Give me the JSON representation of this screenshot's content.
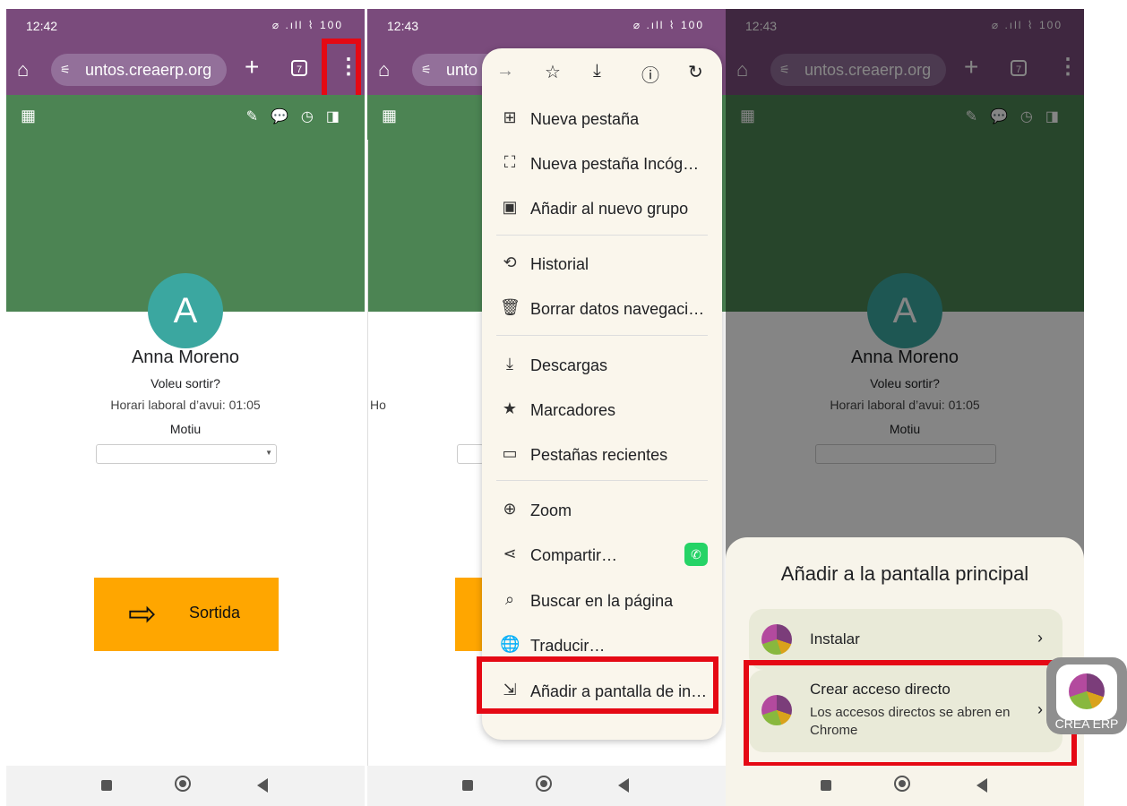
{
  "status": {
    "time1": "12:42",
    "time2": "12:43",
    "time3": "12:43",
    "icons": "⌀ .ıll ⌇ 100"
  },
  "browser": {
    "url": "untos.creaerp.org",
    "url_truncated": "unto",
    "tab_count": "7"
  },
  "profile": {
    "initial": "A",
    "name": "Anna Moreno",
    "question": "Voleu sortir?",
    "hours": "Horari laboral d’avui: 01:05",
    "hours_partial": "Ho",
    "reason_label": "Motiu",
    "exit_button": "Sortida"
  },
  "menu": {
    "items": [
      {
        "label": "Nueva pestaña",
        "icon": "plus-box-icon"
      },
      {
        "label": "Nueva pestaña Incóg…",
        "icon": "incognito-icon"
      },
      {
        "label": "Añadir al nuevo grupo",
        "icon": "group-icon"
      },
      {
        "label": "Historial",
        "icon": "history-icon"
      },
      {
        "label": "Borrar datos navegaci…",
        "icon": "trash-icon"
      },
      {
        "label": "Descargas",
        "icon": "download-check-icon"
      },
      {
        "label": "Marcadores",
        "icon": "star-icon"
      },
      {
        "label": "Pestañas recientes",
        "icon": "devices-icon"
      },
      {
        "label": "Zoom",
        "icon": "zoom-icon"
      },
      {
        "label": "Compartir…",
        "icon": "share-icon"
      },
      {
        "label": "Buscar en la página",
        "icon": "find-icon"
      },
      {
        "label": "Traducir…",
        "icon": "translate-icon"
      },
      {
        "label": "Añadir a pantalla de in…",
        "icon": "add-to-home-icon"
      }
    ]
  },
  "sheet": {
    "title": "Añadir a la pantalla principal",
    "install": "Instalar",
    "shortcut_title": "Crear acceso directo",
    "shortcut_sub": "Los accesos directos se abren en Chrome"
  },
  "app_icon_label": "CREA ERP",
  "colors": {
    "toolbar": "#7a4b7c",
    "header": "#4c8453",
    "avatar": "#3ba7a0",
    "button": "#ffa600",
    "highlight": "#e50914"
  }
}
